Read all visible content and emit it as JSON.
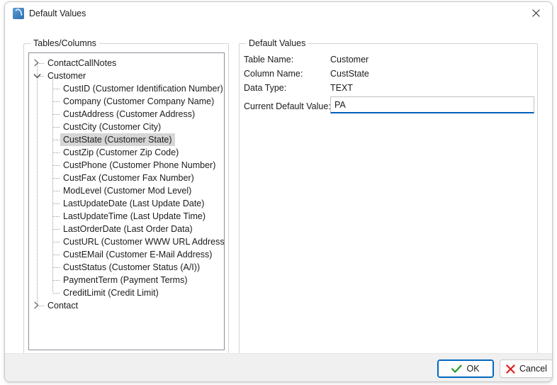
{
  "window": {
    "title": "Default Values",
    "app_icon": "database-swirl-icon",
    "close_icon": "close-icon"
  },
  "tables_group": {
    "label": "Tables/Columns",
    "tree": [
      {
        "label": "ContactCallNotes",
        "level": 0,
        "state": "collapsed",
        "icon": "chevron-right-icon",
        "selected": false
      },
      {
        "label": "Customer",
        "level": 0,
        "state": "expanded",
        "icon": "chevron-down-icon",
        "selected": false
      },
      {
        "label": "CustID  (Customer Identification Number)",
        "level": 1,
        "state": "leaf",
        "icon": "",
        "selected": false
      },
      {
        "label": "Company  (Customer Company Name)",
        "level": 1,
        "state": "leaf",
        "icon": "",
        "selected": false
      },
      {
        "label": "CustAddress  (Customer Address)",
        "level": 1,
        "state": "leaf",
        "icon": "",
        "selected": false
      },
      {
        "label": "CustCity  (Customer City)",
        "level": 1,
        "state": "leaf",
        "icon": "",
        "selected": false
      },
      {
        "label": "CustState  (Customer State)",
        "level": 1,
        "state": "leaf",
        "icon": "",
        "selected": true
      },
      {
        "label": "CustZip  (Customer Zip Code)",
        "level": 1,
        "state": "leaf",
        "icon": "",
        "selected": false
      },
      {
        "label": "CustPhone  (Customer Phone Number)",
        "level": 1,
        "state": "leaf",
        "icon": "",
        "selected": false
      },
      {
        "label": "CustFax  (Customer Fax Number)",
        "level": 1,
        "state": "leaf",
        "icon": "",
        "selected": false
      },
      {
        "label": "ModLevel  (Customer Mod Level)",
        "level": 1,
        "state": "leaf",
        "icon": "",
        "selected": false
      },
      {
        "label": "LastUpdateDate  (Last Update Date)",
        "level": 1,
        "state": "leaf",
        "icon": "",
        "selected": false
      },
      {
        "label": "LastUpdateTime  (Last Update Time)",
        "level": 1,
        "state": "leaf",
        "icon": "",
        "selected": false
      },
      {
        "label": "LastOrderDate  (Last Order Data)",
        "level": 1,
        "state": "leaf",
        "icon": "",
        "selected": false
      },
      {
        "label": "CustURL  (Customer WWW URL Address)",
        "level": 1,
        "state": "leaf",
        "icon": "",
        "selected": false
      },
      {
        "label": "CustEMail  (Customer E-Mail Address)",
        "level": 1,
        "state": "leaf",
        "icon": "",
        "selected": false
      },
      {
        "label": "CustStatus  (Customer Status (A/I))",
        "level": 1,
        "state": "leaf",
        "icon": "",
        "selected": false
      },
      {
        "label": "PaymentTerm  (Payment Terms)",
        "level": 1,
        "state": "leaf",
        "icon": "",
        "selected": false
      },
      {
        "label": "CreditLimit  (Credit Limit)",
        "level": 1,
        "state": "leaf",
        "icon": "",
        "selected": false
      },
      {
        "label": "Contact",
        "level": 0,
        "state": "collapsed",
        "icon": "chevron-right-icon",
        "selected": false
      }
    ]
  },
  "defaults_group": {
    "label": "Default Values",
    "table_name_label": "Table Name:",
    "table_name_value": "Customer",
    "column_name_label": "Column Name:",
    "column_name_value": "CustState",
    "data_type_label": "Data Type:",
    "data_type_value": "TEXT",
    "current_default_label": "Current Default Value:",
    "current_default_value": "PA",
    "current_default_placeholder": ""
  },
  "footer": {
    "ok_label": "OK",
    "ok_icon": "green-check-icon",
    "cancel_label": "Cancel",
    "cancel_icon": "red-x-icon"
  },
  "colors": {
    "accent": "#005fb8",
    "focus_ring": "#0067c0",
    "check_green": "#1f9a1f",
    "cancel_red": "#e01b1b",
    "selection_gray": "#d6d6d6",
    "footer_bg": "#f0f0f0"
  }
}
